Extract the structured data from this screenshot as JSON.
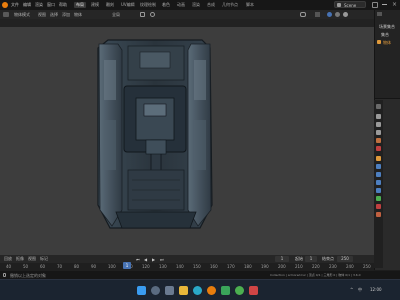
{
  "menu": [
    "文件",
    "编辑",
    "渲染",
    "窗口",
    "帮助"
  ],
  "workspace_tabs": [
    "布局",
    "建模",
    "雕刻",
    "UV编辑",
    "纹理绘制",
    "着色",
    "动画",
    "渲染",
    "合成",
    "几何节点",
    "脚本"
  ],
  "scene": {
    "name": "Scene"
  },
  "viewport_header": {
    "mode": "物体模式",
    "menu": [
      "视图",
      "选择",
      "添加",
      "物体"
    ],
    "transform": "全局"
  },
  "outliner": {
    "header": "场景集合",
    "items": [
      "集合",
      "物体"
    ]
  },
  "timeline": {
    "header": [
      "回放",
      "抠像",
      "视图",
      "标记"
    ],
    "ticks": [
      "40",
      "50",
      "60",
      "70",
      "80",
      "90",
      "100",
      "110",
      "120",
      "130",
      "140",
      "150",
      "160",
      "170",
      "180",
      "190",
      "200",
      "210",
      "220",
      "230",
      "240",
      "250"
    ],
    "current_frame": "1",
    "start_label": "起始",
    "start": "1",
    "end_label": "结束点",
    "end": "250"
  },
  "statusbar": {
    "left": "撤销以上选定的对象",
    "right": "Collection | armored-tur | 顶点 0/1 | 三角形 0 | 物体 0/1 | 3.6.0"
  },
  "taskbar": {
    "time": "12:00",
    "lang": "中"
  },
  "colors": {
    "accent": "#4772b3",
    "viewport_bg": "#3d3d3d",
    "active_object": "#e09a3b"
  }
}
